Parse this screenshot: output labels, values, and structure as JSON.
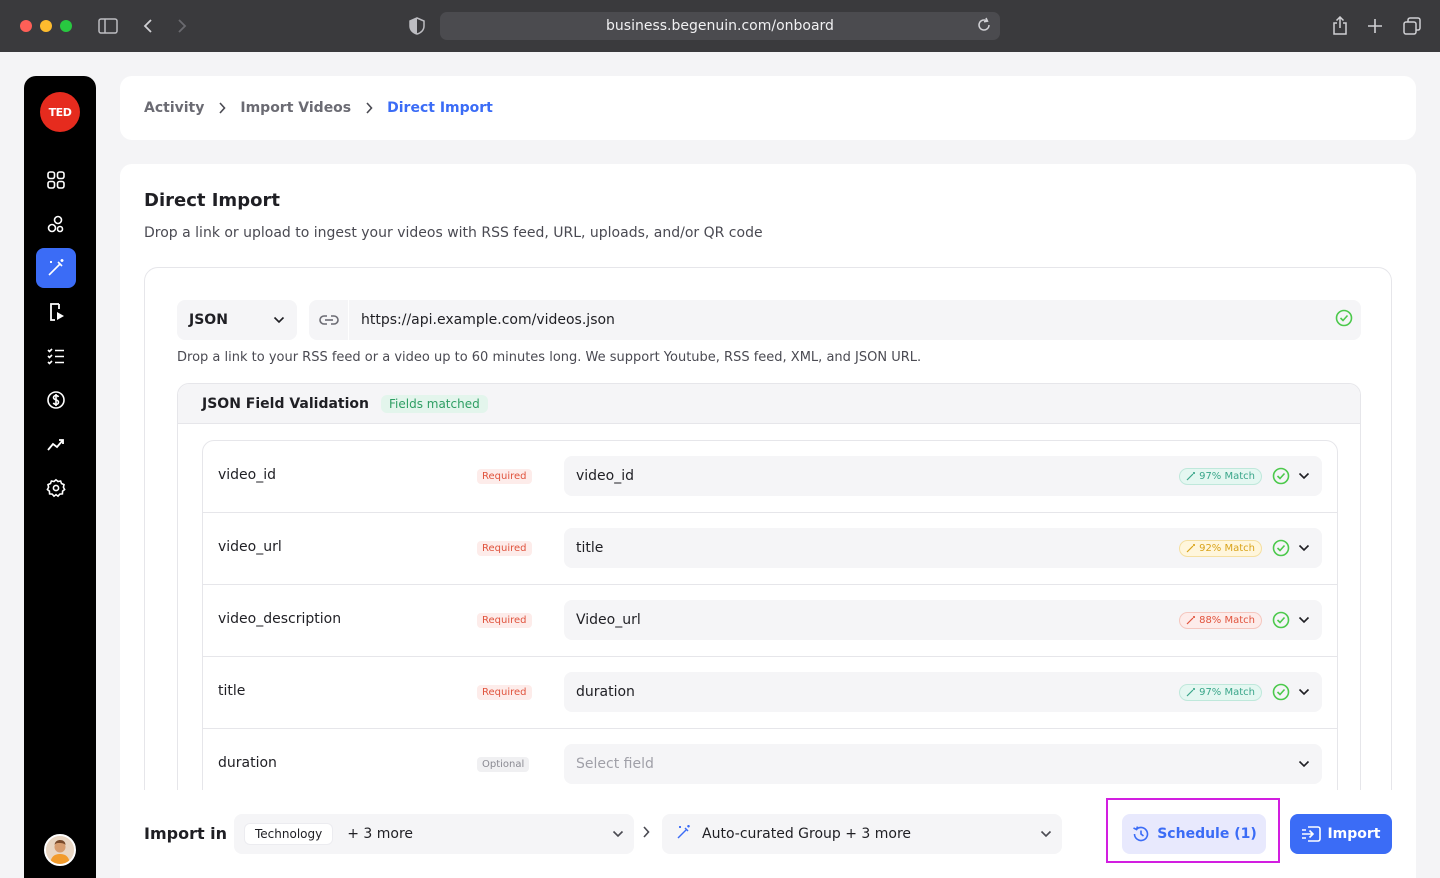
{
  "browser": {
    "url": "business.begenuin.com/onboard"
  },
  "sidebar": {
    "logo_text": "TED",
    "items": [
      {
        "icon": "grid-icon"
      },
      {
        "icon": "community-icon"
      },
      {
        "icon": "magic-wand-icon",
        "active": true
      },
      {
        "icon": "video-file-icon"
      },
      {
        "icon": "list-check-icon"
      },
      {
        "icon": "dollar-icon"
      },
      {
        "icon": "analytics-icon"
      },
      {
        "icon": "settings-icon"
      }
    ]
  },
  "breadcrumb": {
    "items": [
      "Activity",
      "Import Videos",
      "Direct Import"
    ]
  },
  "main": {
    "title": "Direct Import",
    "subtitle": "Drop a link or upload to ingest your videos with RSS feed, URL, uploads, and/or QR code",
    "source_type": "JSON",
    "url_value": "https://api.example.com/videos.json",
    "hint": "Drop a link to your RSS feed or a video up to 60 minutes long. We support Youtube, RSS feed, XML, and JSON URL."
  },
  "validation": {
    "title": "JSON Field Validation",
    "status": "Fields matched",
    "rows": [
      {
        "field": "video_id",
        "tag": "Required",
        "mapped": "video_id",
        "match": "97% Match",
        "match_color": "teal"
      },
      {
        "field": "video_url",
        "tag": "Required",
        "mapped": "title",
        "match": "92% Match",
        "match_color": "yellow"
      },
      {
        "field": "video_description",
        "tag": "Required",
        "mapped": "Video_url",
        "match": "88% Match",
        "match_color": "red"
      },
      {
        "field": "title",
        "tag": "Required",
        "mapped": "duration",
        "match": "97% Match",
        "match_color": "teal"
      },
      {
        "field": "duration",
        "tag": "Optional",
        "mapped": "Select field",
        "match": "",
        "match_color": ""
      }
    ]
  },
  "bottom": {
    "label": "Import in",
    "category_chip": "Technology",
    "category_more": "+ 3 more",
    "group_text": "Auto-curated Group  + 3 more",
    "schedule_label": "Schedule (1)",
    "import_label": "Import"
  },
  "colors": {
    "accent": "#3b6cf6",
    "success": "#4cc94c",
    "highlight": "#d21ee0"
  }
}
